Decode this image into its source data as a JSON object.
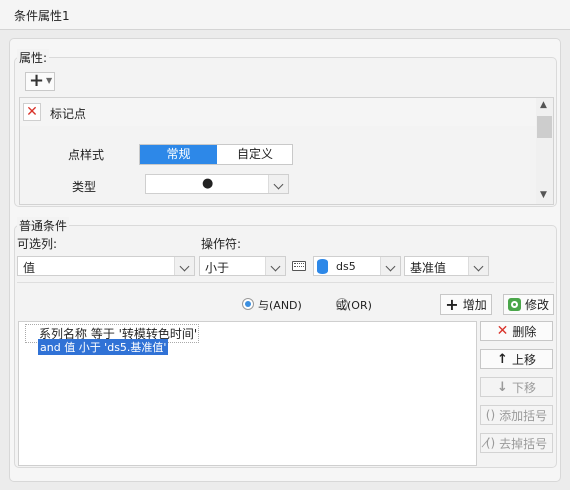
{
  "window": {
    "title": "条件属性1"
  },
  "attributes": {
    "label": "属性:",
    "add_button_glyph": "+",
    "item": {
      "label": "标记点",
      "delete_glyph": "✕"
    },
    "point_style": {
      "label": "点样式",
      "options": [
        "常规",
        "自定义"
      ],
      "selected": "常规"
    },
    "type": {
      "label": "类型",
      "value": "●"
    }
  },
  "general": {
    "label": "普通条件",
    "column": {
      "label": "可选列:",
      "value": "值"
    },
    "operator": {
      "label": "操作符:",
      "value": "小于"
    },
    "ds": {
      "value": "ds5"
    },
    "base": {
      "value": "基准值"
    },
    "logic": {
      "and_label": "与(AND)",
      "or_label": "或(OR)",
      "selected": "and"
    },
    "add_button": "增加",
    "modify_button": "修改",
    "conditions": [
      {
        "text": "系列名称 等于 '转模转色时间'",
        "selected": false
      },
      {
        "text": "and 值 小于 'ds5.基准值'",
        "selected": true
      }
    ],
    "buttons": {
      "delete": "删除",
      "up": "上移",
      "down": "下移",
      "add_bracket": "添加括号",
      "remove_bracket": "去掉括号"
    }
  },
  "colors": {
    "accent": "#2d88e8",
    "selection": "#3072d6",
    "delete_red": "#d9342b"
  }
}
